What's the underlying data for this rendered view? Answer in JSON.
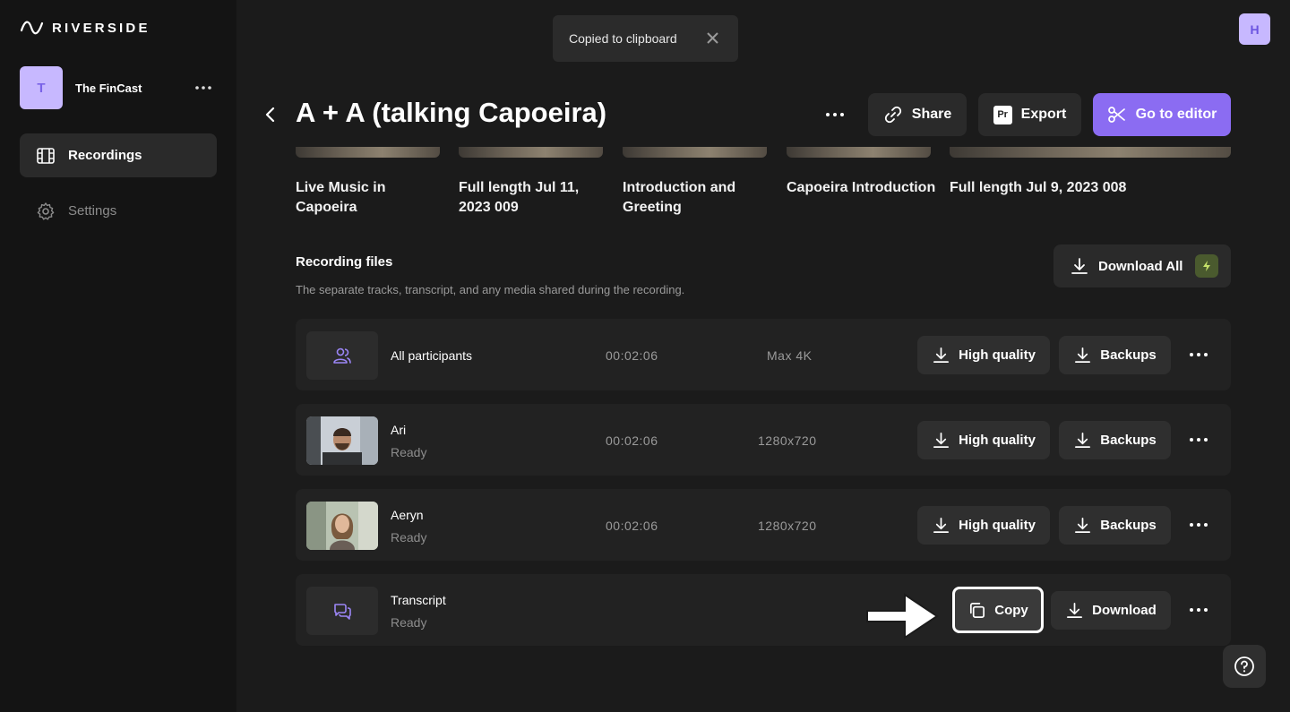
{
  "brand": {
    "name": "RIVERSIDE"
  },
  "workspace": {
    "initial": "T",
    "name": "The FinCast"
  },
  "nav": [
    {
      "label": "Recordings",
      "icon": "film-icon",
      "active": true
    },
    {
      "label": "Settings",
      "icon": "gear-icon",
      "active": false
    }
  ],
  "toast": {
    "message": "Copied to clipboard"
  },
  "user": {
    "initial": "H"
  },
  "header": {
    "title": "A + A (talking Capoeira)",
    "share_label": "Share",
    "export_label": "Export",
    "export_badge": "Pr",
    "editor_label": "Go to editor"
  },
  "clips": [
    {
      "title": "Live Music in Capoeira"
    },
    {
      "title": "Full length Jul 11, 2023 009"
    },
    {
      "title": "Introduction and Greeting"
    },
    {
      "title": "Capoeira Introduction"
    },
    {
      "title": "Full length Jul 9, 2023 008"
    }
  ],
  "recording_files": {
    "title": "Recording files",
    "subtitle": "The separate tracks, transcript, and any media shared during the recording.",
    "download_all_label": "Download All",
    "rows": [
      {
        "name": "All participants",
        "status": "",
        "duration": "00:02:06",
        "resolution": "Max 4K",
        "primary": "High quality",
        "secondary": "Backups"
      },
      {
        "name": "Ari",
        "status": "Ready",
        "duration": "00:02:06",
        "resolution": "1280x720",
        "primary": "High quality",
        "secondary": "Backups"
      },
      {
        "name": "Aeryn",
        "status": "Ready",
        "duration": "00:02:06",
        "resolution": "1280x720",
        "primary": "High quality",
        "secondary": "Backups"
      },
      {
        "name": "Transcript",
        "status": "Ready",
        "duration": "",
        "resolution": "",
        "primary": "Copy",
        "secondary": "Download"
      }
    ]
  },
  "colors": {
    "accent": "#8b6cf2",
    "background": "#1b1b1b",
    "sidebar": "#141414",
    "avatar": "#c7b8ff"
  }
}
